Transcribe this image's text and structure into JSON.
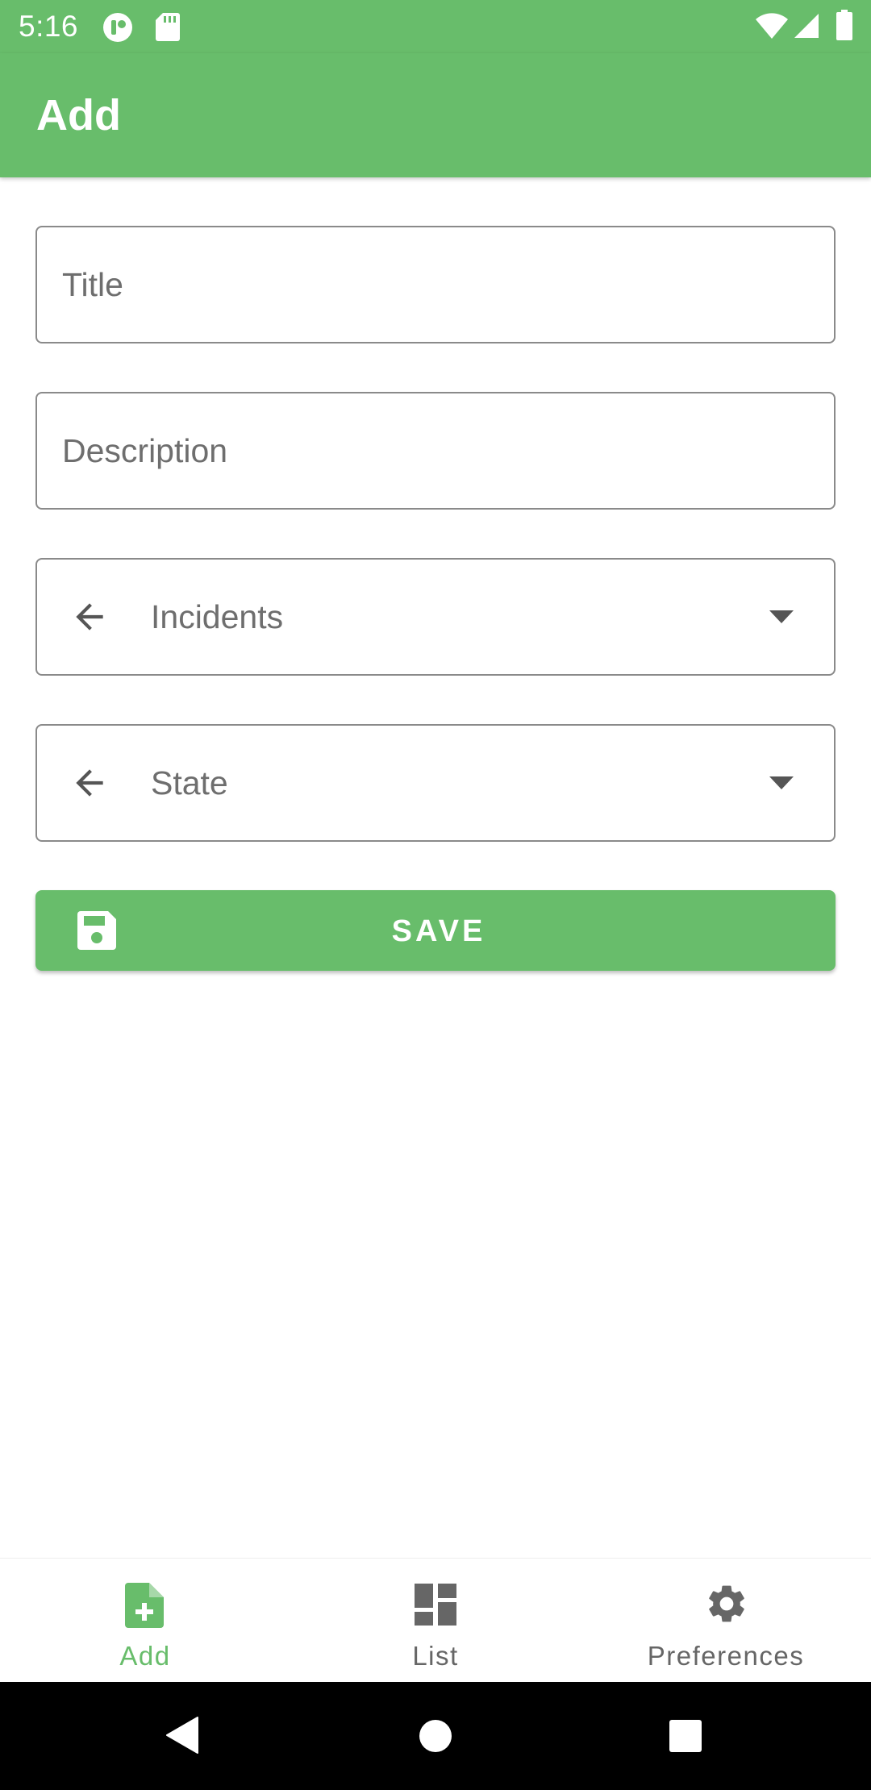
{
  "status_bar": {
    "time": "5:16",
    "icons": [
      "app-notification-icon",
      "sd-card-icon",
      "wifi-icon",
      "signal-icon",
      "battery-icon"
    ]
  },
  "app_bar": {
    "title": "Add"
  },
  "form": {
    "title_placeholder": "Title",
    "description_placeholder": "Description",
    "incidents_dropdown": {
      "value": "Incidents",
      "icon": "arrow-back-icon"
    },
    "state_dropdown": {
      "value": "State",
      "icon": "arrow-back-icon"
    },
    "save_button": {
      "label": "SAVE",
      "icon": "floppy-disk-icon"
    }
  },
  "bottom_nav": {
    "items": [
      {
        "label": "Add",
        "icon": "note-add-icon",
        "active": true
      },
      {
        "label": "List",
        "icon": "dashboard-icon",
        "active": false
      },
      {
        "label": "Preferences",
        "icon": "gear-icon",
        "active": false
      }
    ]
  },
  "system_nav": {
    "buttons": [
      "back-triangle-icon",
      "home-circle-icon",
      "recents-square-icon"
    ]
  },
  "colors": {
    "primary": "#68bd6b",
    "border": "#8a8a8a",
    "placeholder": "#6e6e6e",
    "inactive_nav": "#666666"
  }
}
